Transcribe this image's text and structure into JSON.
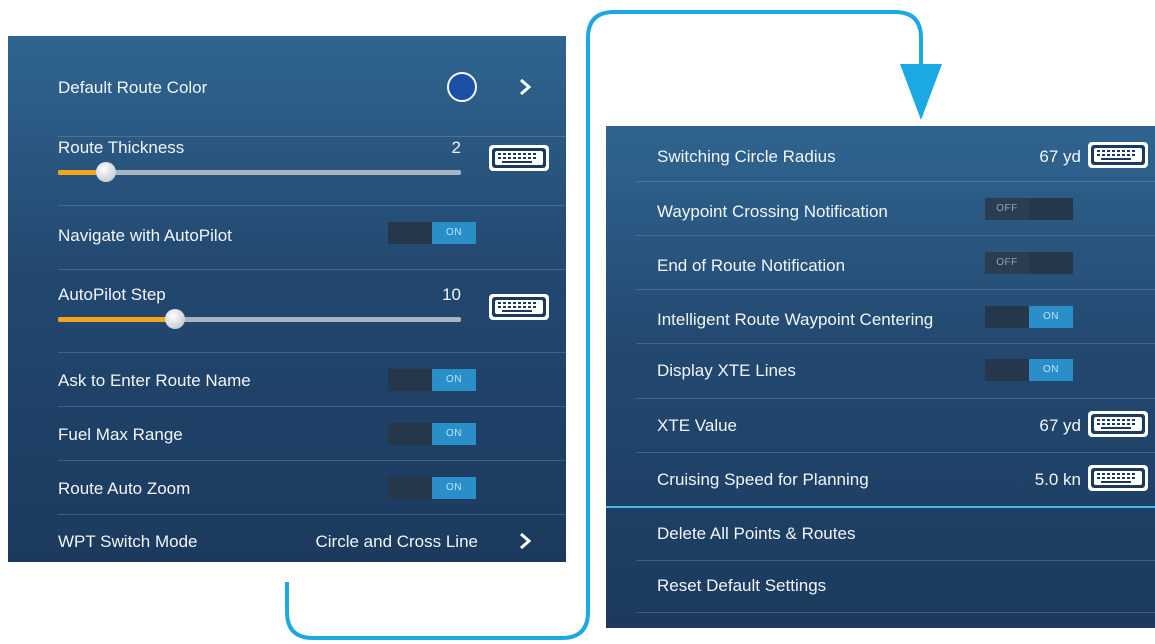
{
  "colors": {
    "accent": "#1aa9e3",
    "route_color": "#1e4fa6",
    "slider_fill": "#f4a51c"
  },
  "left": {
    "default_route_color": {
      "label": "Default Route Color",
      "icon": "chevron-right-icon"
    },
    "route_thickness": {
      "label": "Route Thickness",
      "value": "2",
      "level": 0.12
    },
    "navigate_autopilot": {
      "label": "Navigate with AutoPilot",
      "toggle": "ON"
    },
    "autopilot_step": {
      "label": "AutoPilot Step",
      "value": "10",
      "level": 0.29
    },
    "ask_route_name": {
      "label": "Ask to Enter Route Name",
      "toggle": "ON"
    },
    "fuel_max_range": {
      "label": "Fuel Max Range",
      "toggle": "ON"
    },
    "route_auto_zoom": {
      "label": "Route Auto Zoom",
      "toggle": "ON"
    },
    "wpt_switch_mode": {
      "label": "WPT Switch Mode",
      "value": "Circle and Cross Line"
    }
  },
  "right": {
    "switching_circle": {
      "label": "Switching Circle Radius",
      "value": "67 yd"
    },
    "waypoint_crossing": {
      "label": "Waypoint Crossing Notification",
      "toggle": "OFF"
    },
    "end_of_route": {
      "label": "End of Route Notification",
      "toggle": "OFF"
    },
    "intelligent_centering": {
      "label": "Intelligent Route Waypoint Centering",
      "toggle": "ON"
    },
    "display_xte": {
      "label": "Display XTE Lines",
      "toggle": "ON"
    },
    "xte_value": {
      "label": "XTE Value",
      "value": "67 yd"
    },
    "cruising_speed": {
      "label": "Cruising Speed for Planning",
      "value": "5.0 kn"
    },
    "delete_all": {
      "label": "Delete All Points & Routes"
    },
    "reset_defaults": {
      "label": "Reset Default Settings"
    }
  }
}
